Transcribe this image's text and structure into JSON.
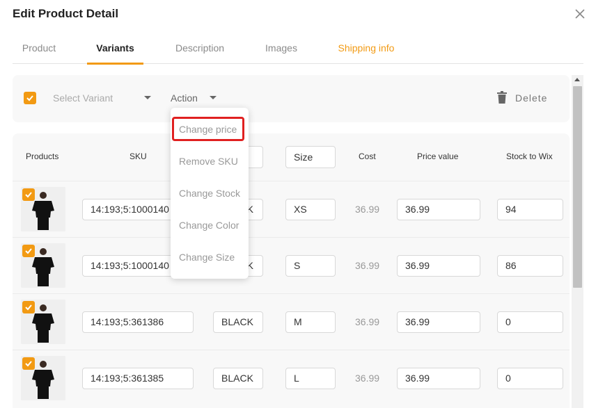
{
  "modal": {
    "title": "Edit Product Detail"
  },
  "tabs": [
    {
      "label": "Product"
    },
    {
      "label": "Variants"
    },
    {
      "label": "Description"
    },
    {
      "label": "Images"
    },
    {
      "label": "Shipping info"
    }
  ],
  "toolbar": {
    "select_variant_placeholder": "Select Variant",
    "action_label": "Action",
    "delete_label": "Delete"
  },
  "dropdown": {
    "items": [
      "Change price",
      "Remove SKU",
      "Change Stock",
      "Change Color",
      "Change Size"
    ]
  },
  "table": {
    "headers": {
      "products": "Products",
      "sku": "SKU",
      "size": "Size",
      "cost": "Cost",
      "price": "Price value",
      "stock": "Stock to Wix"
    },
    "rows": [
      {
        "sku": "14:193;5:1000140",
        "color": "BLACK",
        "size": "XS",
        "cost": "36.99",
        "price": "36.99",
        "stock": "94"
      },
      {
        "sku": "14:193;5:1000140",
        "color": "BLACK",
        "size": "S",
        "cost": "36.99",
        "price": "36.99",
        "stock": "86"
      },
      {
        "sku": "14:193;5:361386",
        "color": "BLACK",
        "size": "M",
        "cost": "36.99",
        "price": "36.99",
        "stock": "0"
      },
      {
        "sku": "14:193;5:361385",
        "color": "BLACK",
        "size": "L",
        "cost": "36.99",
        "price": "36.99",
        "stock": "0"
      }
    ]
  },
  "colors": {
    "accent": "#f29a13",
    "highlight": "#e02020"
  }
}
